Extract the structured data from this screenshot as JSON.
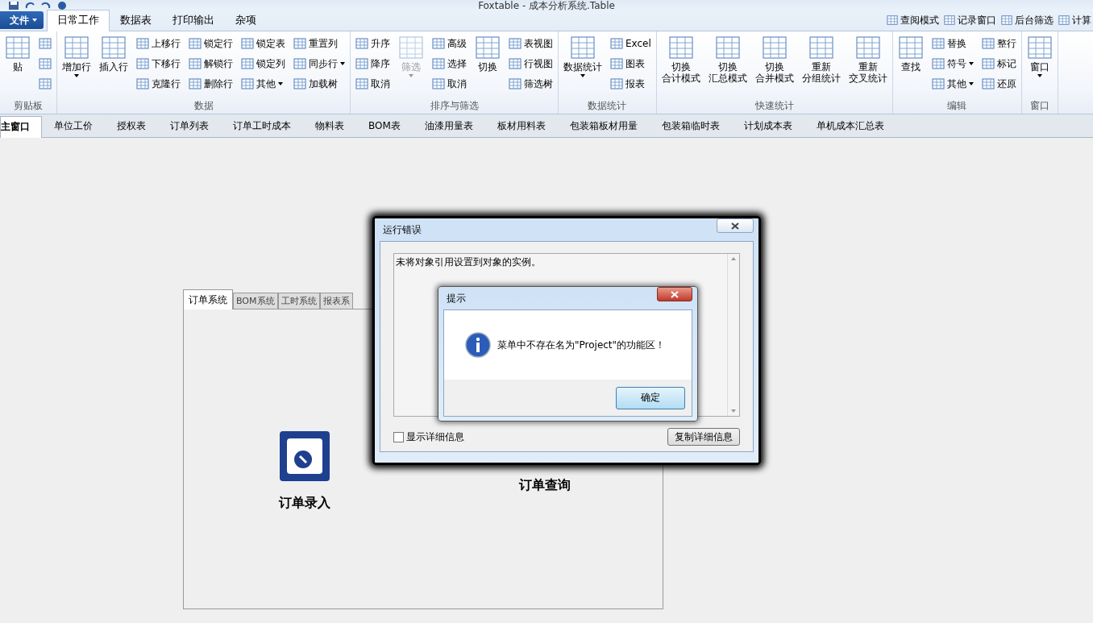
{
  "window": {
    "title": "Foxtable - 成本分析系统.Table"
  },
  "ribbon_tabs": {
    "file": "文件",
    "tabs": [
      {
        "label": "日常工作",
        "selected": true
      },
      {
        "label": "数据表",
        "selected": false
      },
      {
        "label": "打印输出",
        "selected": false
      },
      {
        "label": "杂项",
        "selected": false
      }
    ],
    "right_items": [
      "查阅模式",
      "记录窗口",
      "后台筛选",
      "计算"
    ]
  },
  "ribbon_groups": [
    {
      "label": "剪贴板",
      "columns": [
        [
          {
            "kind": "large",
            "label": "贴"
          }
        ],
        [
          {
            "kind": "icon"
          },
          {
            "kind": "icon"
          },
          {
            "kind": "icon"
          }
        ]
      ]
    },
    {
      "label": "数据",
      "columns": [
        [
          {
            "kind": "large",
            "label": "增加行",
            "dropdown": true
          }
        ],
        [
          {
            "kind": "large",
            "label": "插入行"
          }
        ],
        [
          {
            "kind": "small",
            "label": "上移行"
          },
          {
            "kind": "small",
            "label": "下移行"
          },
          {
            "kind": "small",
            "label": "克隆行"
          }
        ],
        [
          {
            "kind": "small",
            "label": "锁定行"
          },
          {
            "kind": "small",
            "label": "解锁行"
          },
          {
            "kind": "small",
            "label": "删除行"
          }
        ],
        [
          {
            "kind": "small",
            "label": "锁定表"
          },
          {
            "kind": "small",
            "label": "锁定列"
          },
          {
            "kind": "small",
            "label": "其他",
            "dropdown": true
          }
        ],
        [
          {
            "kind": "small",
            "label": "重置列"
          },
          {
            "kind": "small",
            "label": "同步行",
            "dropdown": true
          },
          {
            "kind": "small",
            "label": "加载树"
          }
        ]
      ]
    },
    {
      "label": "排序与筛选",
      "columns": [
        [
          {
            "kind": "small",
            "label": "升序"
          },
          {
            "kind": "small",
            "label": "降序"
          },
          {
            "kind": "small",
            "label": "取消"
          }
        ],
        [
          {
            "kind": "large",
            "label": "筛选",
            "dropdown": true,
            "disabled": true
          }
        ],
        [
          {
            "kind": "small",
            "label": "高级"
          },
          {
            "kind": "small",
            "label": "选择"
          },
          {
            "kind": "small",
            "label": "取消"
          }
        ],
        [
          {
            "kind": "large",
            "label": "切换"
          }
        ],
        [
          {
            "kind": "small",
            "label": "表视图"
          },
          {
            "kind": "small",
            "label": "行视图"
          },
          {
            "kind": "small",
            "label": "筛选树"
          }
        ]
      ]
    },
    {
      "label": "数据统计",
      "columns": [
        [
          {
            "kind": "large",
            "label": "数据统计",
            "dropdown": true
          }
        ],
        [
          {
            "kind": "small",
            "label": "Excel"
          },
          {
            "kind": "small",
            "label": "图表"
          },
          {
            "kind": "small",
            "label": "报表"
          }
        ]
      ]
    },
    {
      "label": "快速统计",
      "columns": [
        [
          {
            "kind": "large",
            "lines": [
              "切换",
              "合计模式"
            ]
          }
        ],
        [
          {
            "kind": "large",
            "lines": [
              "切换",
              "汇总模式"
            ]
          }
        ],
        [
          {
            "kind": "large",
            "lines": [
              "切换",
              "合并模式"
            ]
          }
        ],
        [
          {
            "kind": "large",
            "lines": [
              "重新",
              "分组统计"
            ]
          }
        ],
        [
          {
            "kind": "large",
            "lines": [
              "重新",
              "交叉统计"
            ]
          }
        ]
      ]
    },
    {
      "label": "编辑",
      "columns": [
        [
          {
            "kind": "large",
            "label": "查找"
          }
        ],
        [
          {
            "kind": "small",
            "label": "替换"
          },
          {
            "kind": "small",
            "label": "符号",
            "dropdown": true
          },
          {
            "kind": "small",
            "label": "其他",
            "dropdown": true
          }
        ],
        [
          {
            "kind": "small",
            "label": "整行"
          },
          {
            "kind": "small",
            "label": "标记"
          },
          {
            "kind": "small",
            "label": "还原"
          }
        ]
      ]
    },
    {
      "label": "窗口",
      "columns": [
        [
          {
            "kind": "large",
            "label": "窗口",
            "dropdown": true
          }
        ]
      ]
    }
  ],
  "doc_tabs": [
    {
      "label": "主窗口",
      "selected": true
    },
    {
      "label": "单位工价",
      "selected": false
    },
    {
      "label": "授权表",
      "selected": false
    },
    {
      "label": "订单列表",
      "selected": false
    },
    {
      "label": "订单工时成本",
      "selected": false
    },
    {
      "label": "物料表",
      "selected": false
    },
    {
      "label": "BOM表",
      "selected": false
    },
    {
      "label": "油漆用量表",
      "selected": false
    },
    {
      "label": "板材用料表",
      "selected": false
    },
    {
      "label": "包装箱板材用量",
      "selected": false
    },
    {
      "label": "包装箱临时表",
      "selected": false
    },
    {
      "label": "计划成本表",
      "selected": false
    },
    {
      "label": "单机成本汇总表",
      "selected": false
    }
  ],
  "system_tabs": [
    {
      "label": "订单系统",
      "selected": true
    },
    {
      "label": "BOM系统",
      "selected": false
    },
    {
      "label": "工时系统",
      "selected": false
    },
    {
      "label": "报表系",
      "selected": false
    }
  ],
  "launchers": [
    "订单录入",
    "订单查询"
  ],
  "error_dialog": {
    "title": "运行错误",
    "message": "未将对象引用设置到对象的实例。",
    "show_details": {
      "label": "显示详细信息",
      "checked": false
    },
    "copy_button": "复制详细信息"
  },
  "prompt_dialog": {
    "title": "提示",
    "message": "菜单中不存在名为\"Project\"的功能区！",
    "ok_button": "确定"
  }
}
